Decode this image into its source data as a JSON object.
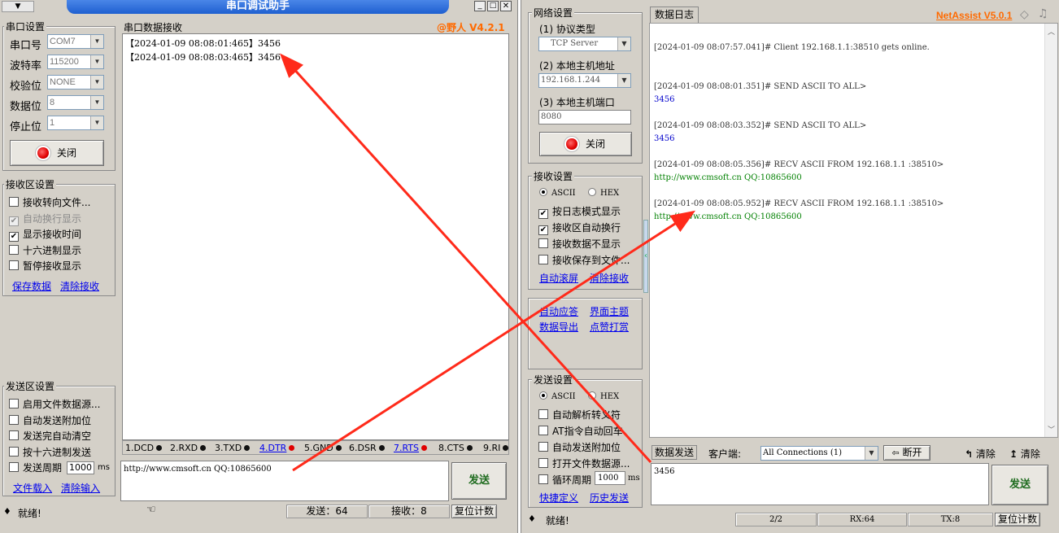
{
  "left": {
    "title": "串口调试助手",
    "serial_group": "串口设置",
    "port_label": "串口号",
    "port_value": "COM7",
    "baud_label": "波特率",
    "baud_value": "115200",
    "parity_label": "校验位",
    "parity_value": "NONE",
    "databits_label": "数据位",
    "databits_value": "8",
    "stopbits_label": "停止位",
    "stopbits_value": "1",
    "close_btn": "关闭",
    "recv_group": "接收区设置",
    "recv_opts": [
      {
        "label": "接收转向文件...",
        "checked": false,
        "disabled": false
      },
      {
        "label": "自动换行显示",
        "checked": true,
        "disabled": true
      },
      {
        "label": "显示接收时间",
        "checked": true,
        "disabled": false
      },
      {
        "label": "十六进制显示",
        "checked": false,
        "disabled": false
      },
      {
        "label": "暂停接收显示",
        "checked": false,
        "disabled": false
      }
    ],
    "save_link": "保存数据",
    "clear_recv_link": "清除接收",
    "send_group": "发送区设置",
    "send_opts": [
      {
        "label": "启用文件数据源...",
        "checked": false
      },
      {
        "label": "自动发送附加位",
        "checked": false
      },
      {
        "label": "发送完自动清空",
        "checked": false
      },
      {
        "label": "按十六进制发送",
        "checked": false
      },
      {
        "label": "发送周期",
        "checked": false
      }
    ],
    "period_value": "1000",
    "period_unit": "ms",
    "load_file_link": "文件载入",
    "clear_input_link": "清除输入",
    "recv_area_title": "串口数据接收",
    "brand": "@野人 V4.2.1",
    "recv_lines": [
      "【2024-01-09 08:08:01:465】3456",
      "【2024-01-09 08:08:03:465】3456"
    ],
    "signals": [
      {
        "label": "1.DCD",
        "link": false,
        "red": false
      },
      {
        "label": "2.RXD",
        "link": false,
        "red": false
      },
      {
        "label": "3.TXD",
        "link": false,
        "red": false
      },
      {
        "label": "4.DTR",
        "link": true,
        "red": true
      },
      {
        "label": "5.GND",
        "link": false,
        "red": false
      },
      {
        "label": "6.DSR",
        "link": false,
        "red": false
      },
      {
        "label": "7.RTS",
        "link": true,
        "red": true
      },
      {
        "label": "8.CTS",
        "link": false,
        "red": false
      },
      {
        "label": "9.RI",
        "link": false,
        "red": false
      }
    ],
    "send_text": "http://www.cmsoft.cn QQ:10865600",
    "send_btn": "发送",
    "status_ready": "就绪!",
    "status_sent": "发送：64",
    "status_recv": "接收：8",
    "reset_btn": "复位计数"
  },
  "right": {
    "net_group": "网络设置",
    "proto_label": "(1) 协议类型",
    "proto_value": "TCP Server",
    "host_label": "(2) 本地主机地址",
    "host_value": "192.168.1.244",
    "port_label": "(3) 本地主机端口",
    "port_value": "8080",
    "close_btn": "关闭",
    "recv_group": "接收设置",
    "ascii": "ASCII",
    "hex": "HEX",
    "recv_opts": [
      {
        "label": "按日志模式显示",
        "checked": true
      },
      {
        "label": "接收区自动换行",
        "checked": true
      },
      {
        "label": "接收数据不显示",
        "checked": false
      },
      {
        "label": "接收保存到文件...",
        "checked": false
      }
    ],
    "auto_scroll_link": "自动滚屏",
    "clear_recv_link": "清除接收",
    "auto_reply_link": "自动应答",
    "theme_link": "界面主题",
    "export_link": "数据导出",
    "donate_link": "点赞打赏",
    "send_group": "发送设置",
    "send_opts": [
      {
        "label": "自动解析转义符",
        "checked": false
      },
      {
        "label": "AT指令自动回车",
        "checked": false
      },
      {
        "label": "自动发送附加位",
        "checked": false
      },
      {
        "label": "打开文件数据源...",
        "checked": false
      },
      {
        "label": "循环周期",
        "checked": false
      }
    ],
    "period_value": "1000",
    "period_unit": "ms",
    "shortcut_link": "快捷定义",
    "history_link": "历史发送",
    "log_tab": "数据日志",
    "brand": "NetAssist V5.0.1",
    "log": [
      {
        "header": "[2024-01-09 08:07:57.041]# Client 192.168.1.1:38510 gets online.",
        "body": ""
      },
      {
        "header": "[2024-01-09 08:08:01.351]# SEND ASCII TO ALL>",
        "body": "3456",
        "type": "send"
      },
      {
        "header": "[2024-01-09 08:08:03.352]# SEND ASCII TO ALL>",
        "body": "3456",
        "type": "send"
      },
      {
        "header": "[2024-01-09 08:08:05.356]# RECV ASCII FROM 192.168.1.1 :38510>",
        "body": "http://www.cmsoft.cn QQ:10865600",
        "type": "recv"
      },
      {
        "header": "[2024-01-09 08:08:05.952]# RECV ASCII FROM 192.168.1.1 :38510>",
        "body": "http://www.cmsoft.cn QQ:10865600",
        "type": "recv"
      }
    ],
    "send_tab": "数据发送",
    "client_label": "客户端:",
    "client_value": "All Connections (1)",
    "disconnect_btn": "断开",
    "clear1": "清除",
    "clear2": "清除",
    "send_text": "3456",
    "send_btn": "发送",
    "status_ready": "就绪!",
    "status_conn": "2/2",
    "status_rx": "RX:64",
    "status_tx": "TX:8",
    "reset_btn": "复位计数"
  },
  "colors": {
    "title_blue": "#1e5fd0",
    "brand_orange": "#ff6a00",
    "log_send": "#0000cc",
    "log_recv": "#008000",
    "arrow_red": "#ff2a1a"
  }
}
